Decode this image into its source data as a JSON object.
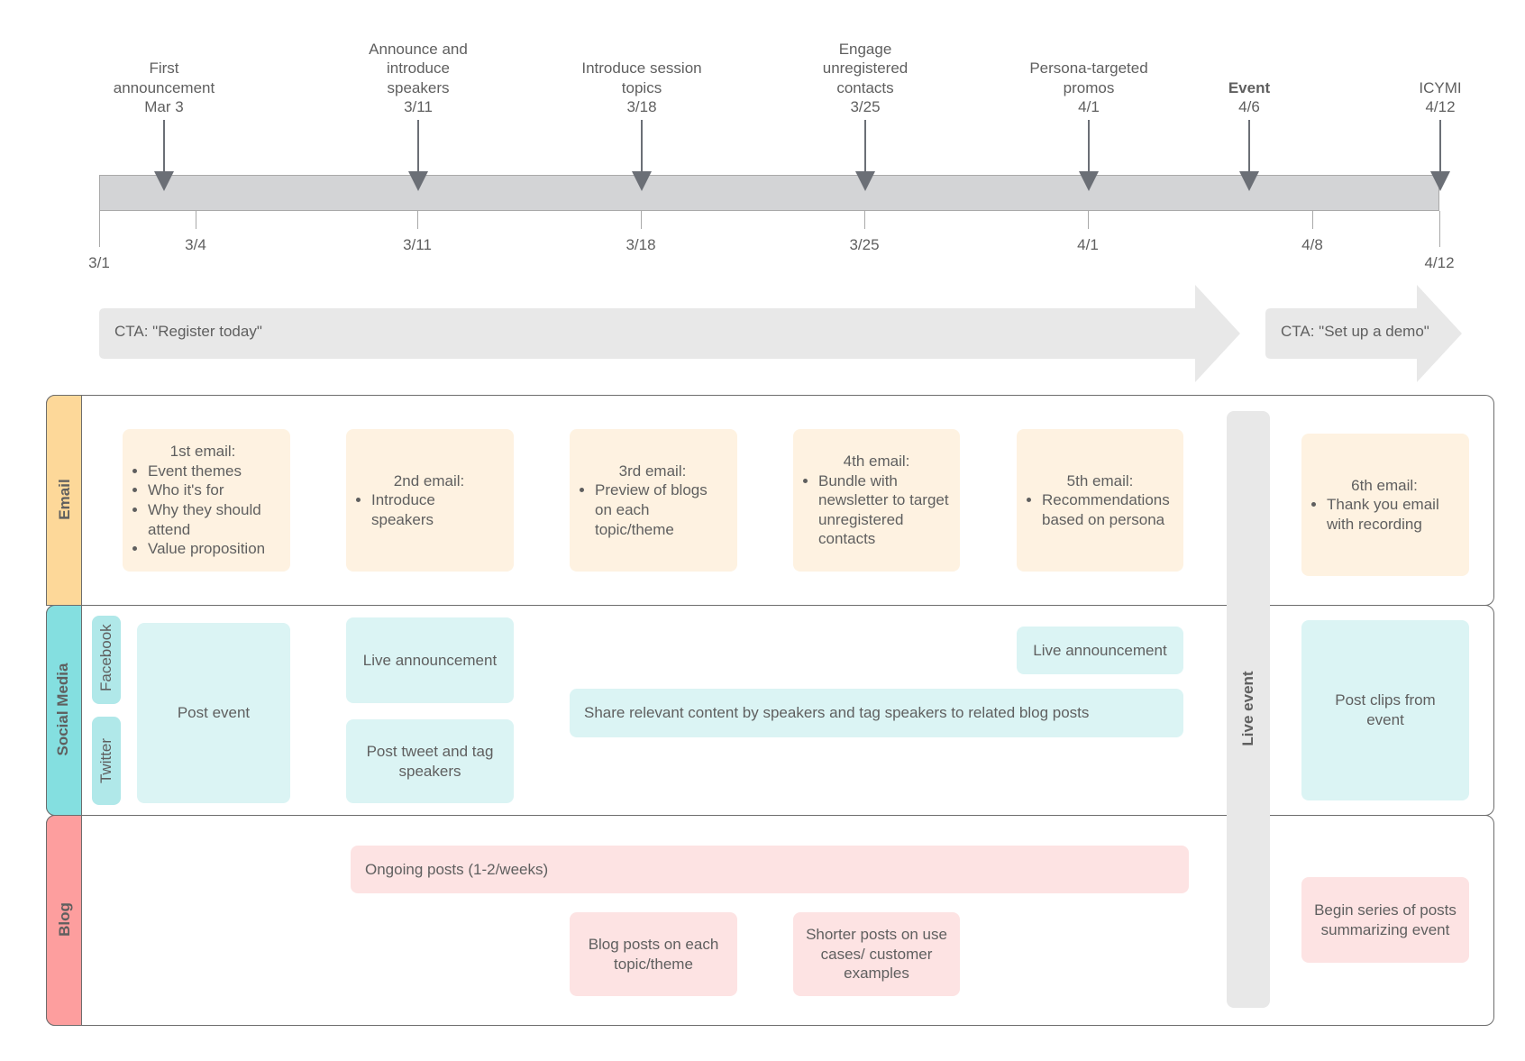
{
  "timeline": {
    "milestones": [
      {
        "title_lines": [
          "First",
          "announcement"
        ],
        "date": "Mar 3",
        "bold": false
      },
      {
        "title_lines": [
          "Announce and",
          "introduce",
          "speakers"
        ],
        "date": "3/11",
        "bold": false
      },
      {
        "title_lines": [
          "Introduce session",
          "topics"
        ],
        "date": "3/18",
        "bold": false
      },
      {
        "title_lines": [
          "Engage",
          "unregistered",
          "contacts"
        ],
        "date": "3/25",
        "bold": false
      },
      {
        "title_lines": [
          "Persona-targeted",
          "promos"
        ],
        "date": "4/1",
        "bold": false
      },
      {
        "title_lines": [
          "Event"
        ],
        "date": "4/6",
        "bold": true
      },
      {
        "title_lines": [
          "ICYMI"
        ],
        "date": "4/12",
        "bold": false
      }
    ],
    "ticks": [
      "3/1",
      "3/4",
      "3/11",
      "3/18",
      "3/25",
      "4/1",
      "4/8",
      "4/12"
    ]
  },
  "cta": {
    "register": "CTA: \"Register today\"",
    "demo": "CTA: \"Set up a demo\""
  },
  "lanes": {
    "email": {
      "title": "Email",
      "color": "#fdd899",
      "cards": [
        {
          "heading": "1st email:",
          "bullets": [
            "Event themes",
            "Who it's for",
            "Why they should attend",
            "Value proposition"
          ]
        },
        {
          "heading": "2nd email:",
          "bullets": [
            "Introduce speakers"
          ]
        },
        {
          "heading": "3rd email:",
          "bullets": [
            "Preview of blogs on each topic/theme"
          ]
        },
        {
          "heading": "4th email:",
          "bullets": [
            "Bundle with newsletter to target unregistered contacts"
          ]
        },
        {
          "heading": "5th email:",
          "bullets": [
            "Recommendations based on persona"
          ]
        },
        {
          "heading": "6th email:",
          "bullets": [
            "Thank you email with recording"
          ]
        }
      ]
    },
    "social": {
      "title": "Social Media",
      "color": "#84dfe0",
      "subchannels": [
        "Facebook",
        "Twitter"
      ],
      "cards": {
        "post_event": "Post event",
        "live_announcement_1": "Live announcement",
        "post_tweet": "Post tweet and tag speakers",
        "live_announcement_2": "Live announcement",
        "share_content": "Share relevant content by speakers and tag speakers to related blog posts",
        "post_clips": "Post clips from event"
      }
    },
    "blog": {
      "title": "Blog",
      "color": "#fd9e9e",
      "cards": {
        "ongoing": "Ongoing posts (1-2/weeks)",
        "topic_posts": "Blog posts on each topic/theme",
        "shorter_posts": "Shorter posts on use cases/ customer examples",
        "summary_series": "Begin series of posts summarizing event"
      }
    }
  },
  "live_event": "Live event"
}
